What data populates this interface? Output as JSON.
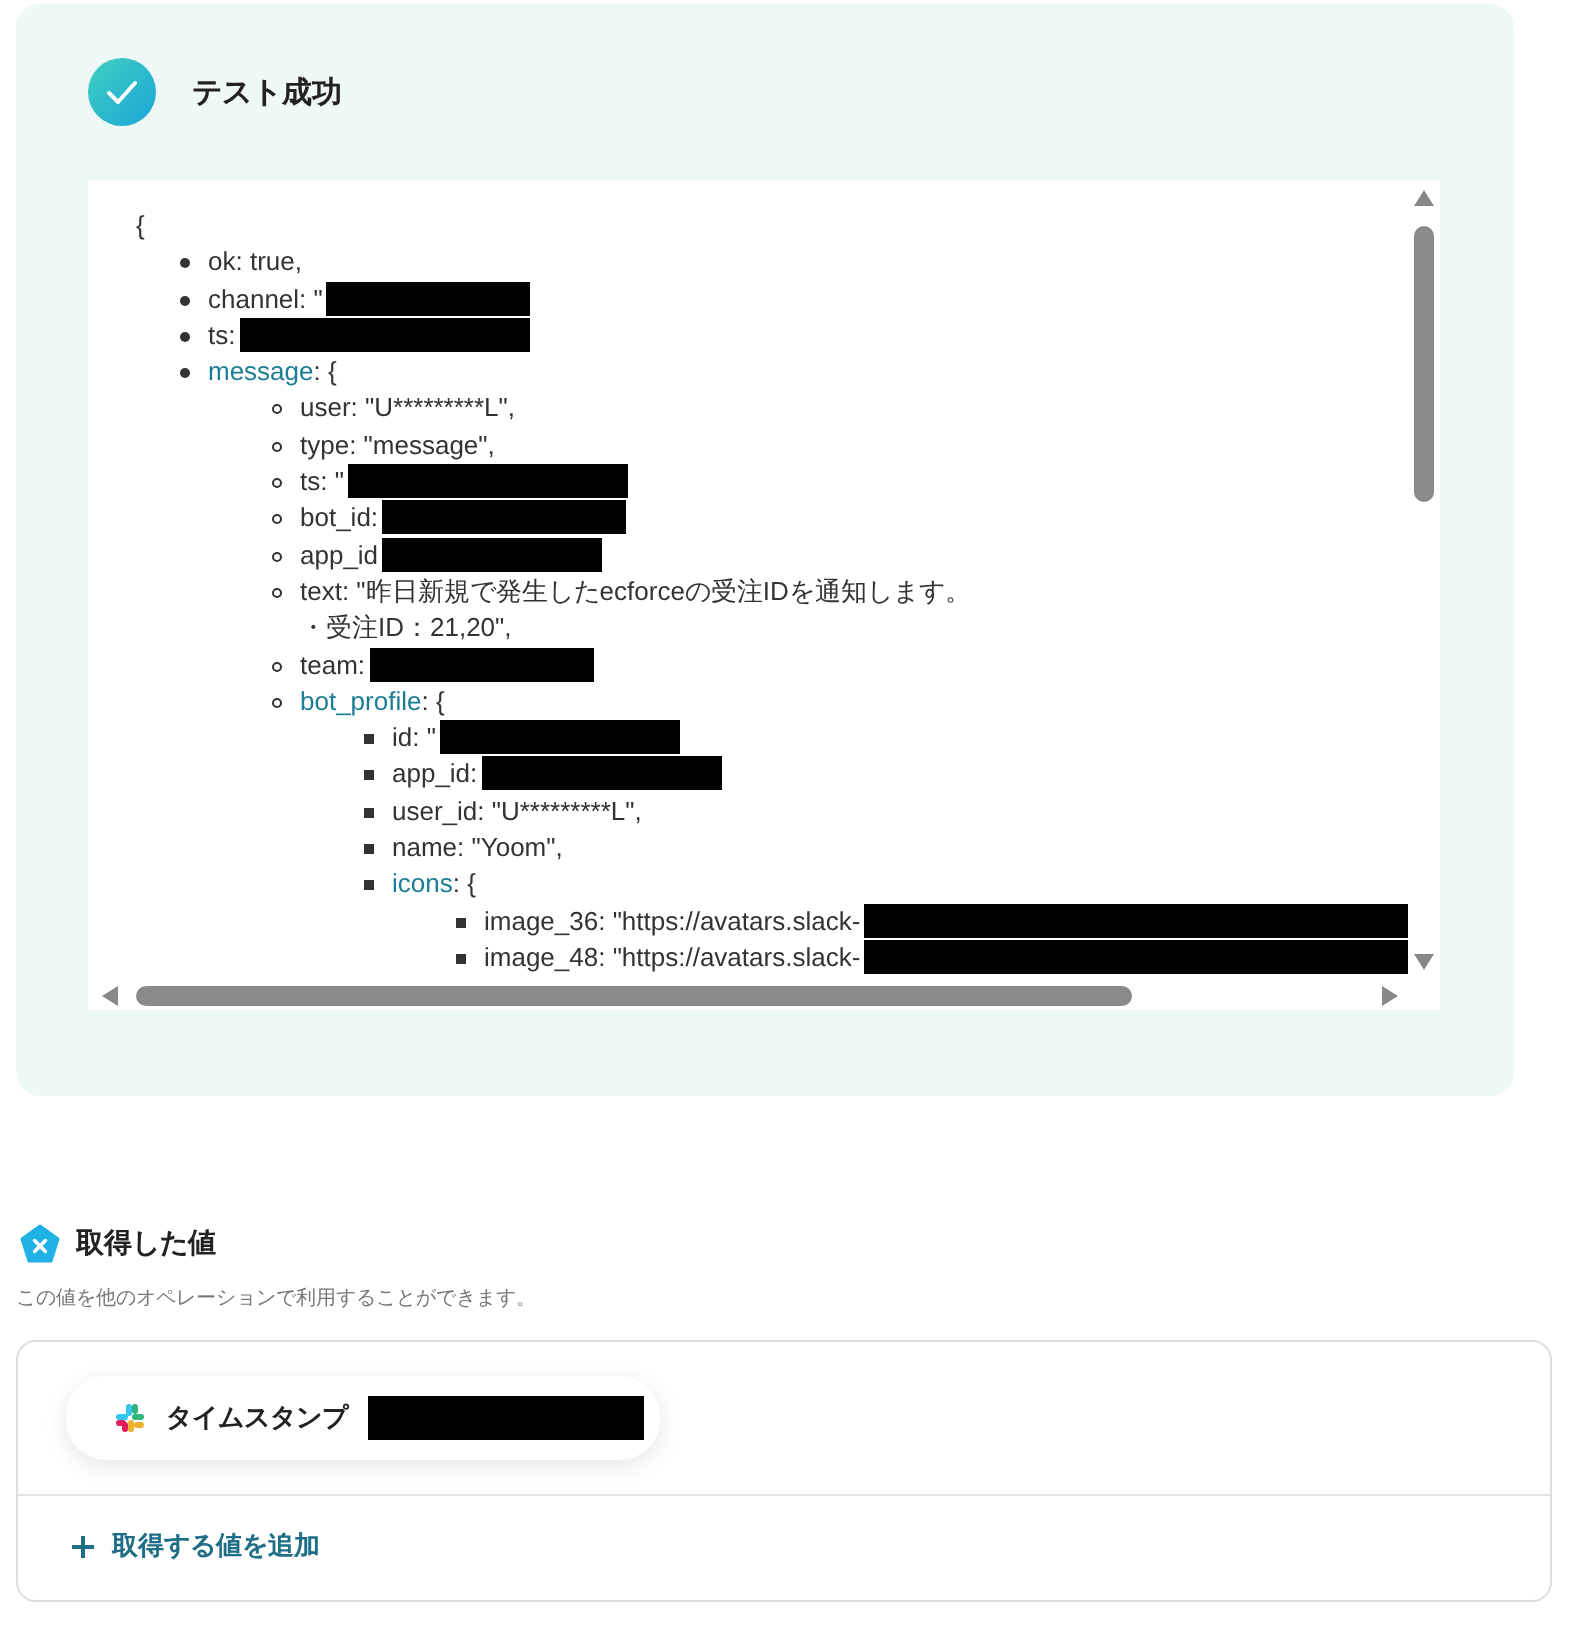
{
  "result": {
    "title": "テスト成功",
    "json_open": "{",
    "items": [
      {
        "text": "ok: true,"
      },
      {
        "text": "channel: \"",
        "redacted": true
      },
      {
        "text": "ts:",
        "redacted": true
      },
      {
        "key": "message",
        "text": ": {",
        "children": [
          {
            "text": "user: \"U*********L\","
          },
          {
            "text": "type: \"message\","
          },
          {
            "text": "ts: \"",
            "redacted": true
          },
          {
            "text": "bot_id:",
            "redacted": true
          },
          {
            "text": "app_id",
            "redacted": true
          },
          {
            "lines": [
              "text: \"昨日新規で発生したecforceの受注IDを通知します。",
              "・受注ID：21,20\","
            ]
          },
          {
            "text": "team:",
            "redacted": true
          },
          {
            "key": "bot_profile",
            "text": ": {",
            "children": [
              {
                "text": "id: \"",
                "redacted": true
              },
              {
                "text": "app_id:",
                "redacted": true
              },
              {
                "text": "user_id: \"U*********L\","
              },
              {
                "text": "name: \"Yoom\","
              },
              {
                "key": "icons",
                "text": ": {",
                "children": [
                  {
                    "text": "image_36: \"https://avatars.slack-",
                    "redacted": true
                  },
                  {
                    "text": "image_48: \"https://avatars.slack-",
                    "redacted": true
                  }
                ]
              }
            ]
          }
        ]
      }
    ]
  },
  "values_section": {
    "title": "取得した値",
    "description": "この値を他のオペレーションで利用することができます。",
    "values": [
      {
        "label": "タイムスタンプ",
        "redacted": true
      }
    ],
    "add_button": "取得する値を追加"
  }
}
